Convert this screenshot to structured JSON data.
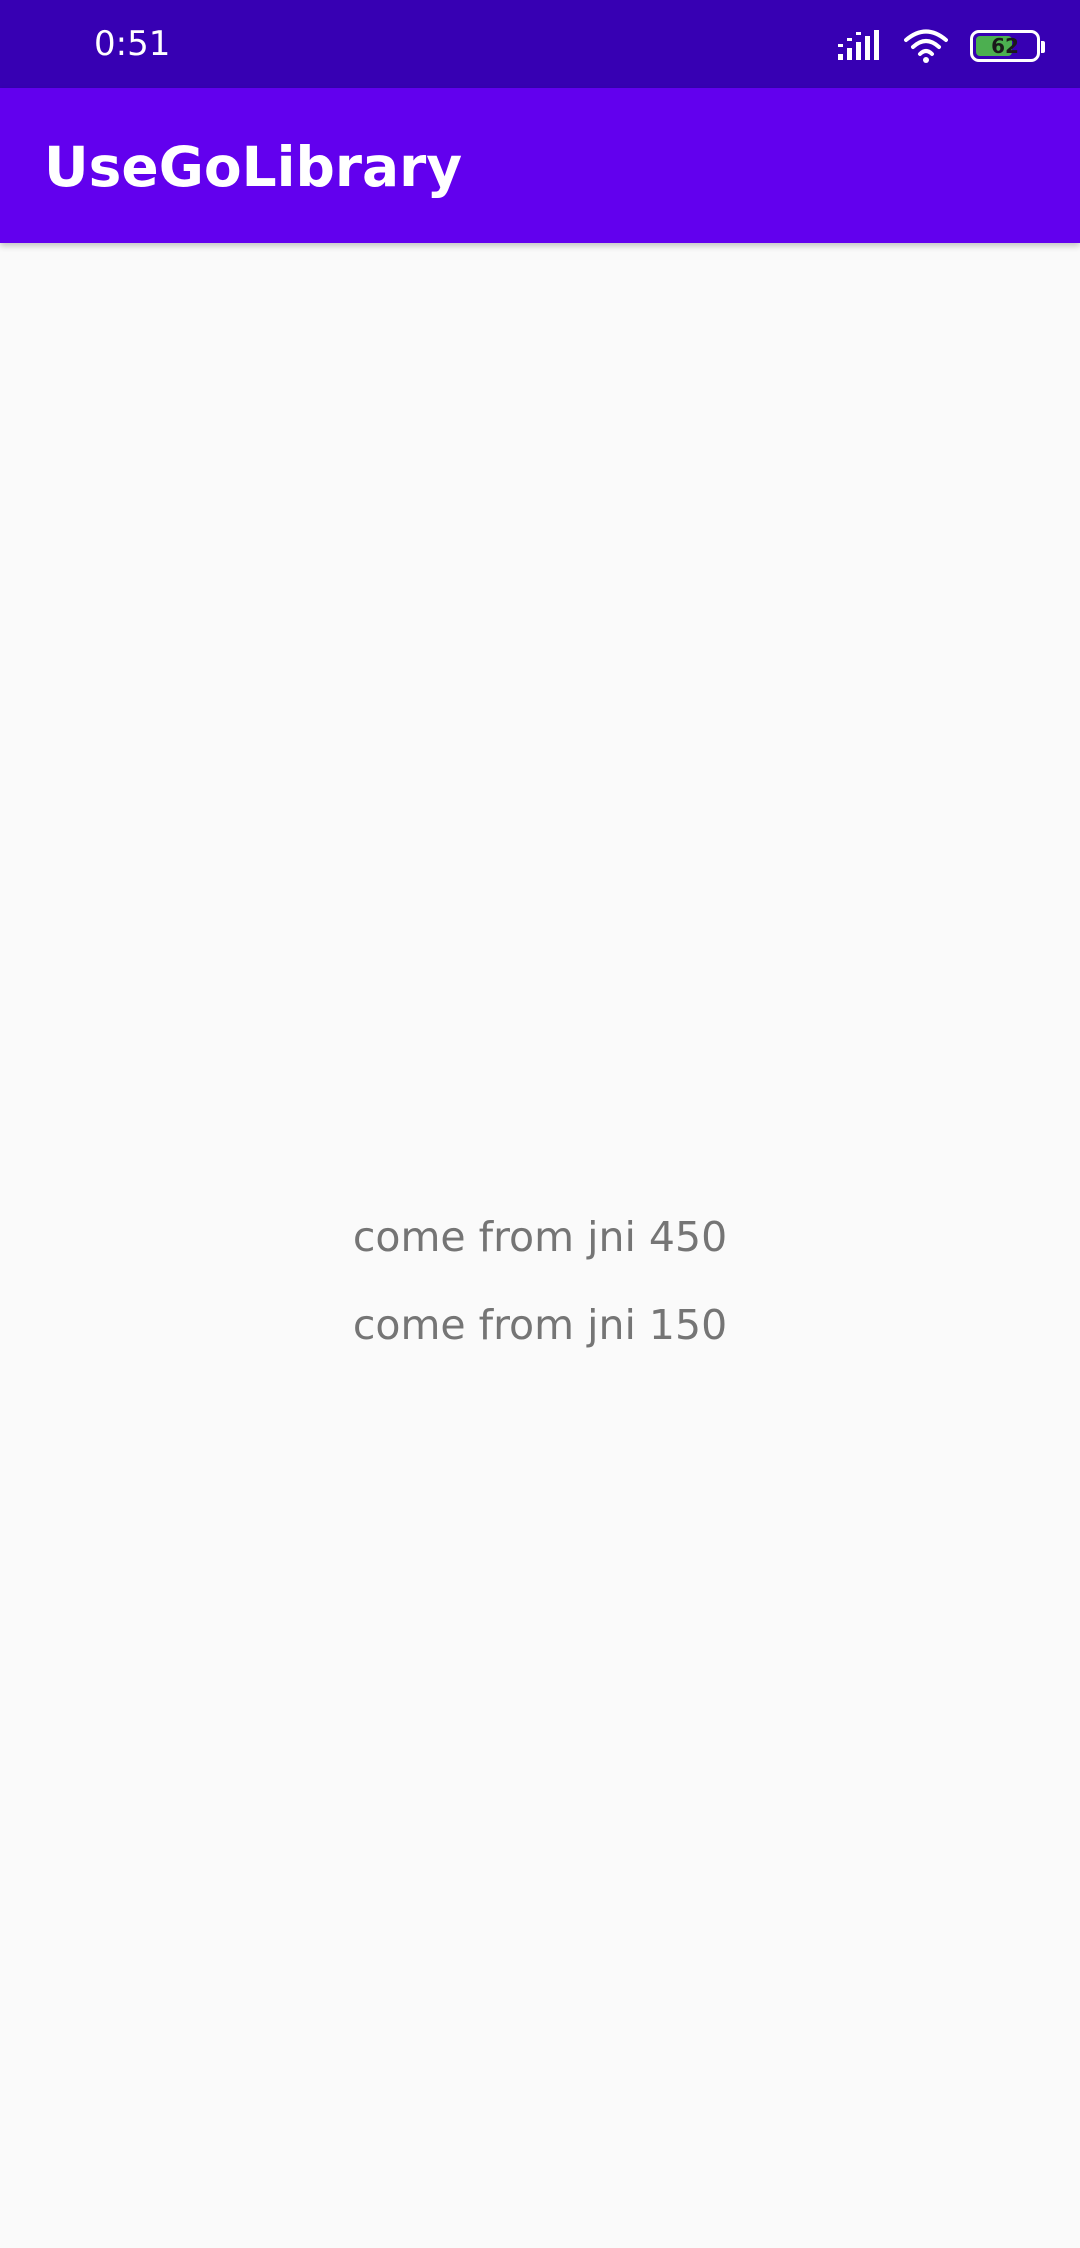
{
  "status_bar": {
    "time": "0:51",
    "battery_level": "62",
    "battery_fraction": 0.62,
    "icons": [
      "signal-icon",
      "wifi-icon",
      "battery-icon"
    ],
    "background": "#3700B3"
  },
  "app_bar": {
    "title": "UseGoLibrary",
    "background": "#6200EE"
  },
  "content": {
    "lines": [
      "come from jni 450",
      "come from jni 150"
    ],
    "text_color": "#757575",
    "background": "#FAFAFA"
  }
}
